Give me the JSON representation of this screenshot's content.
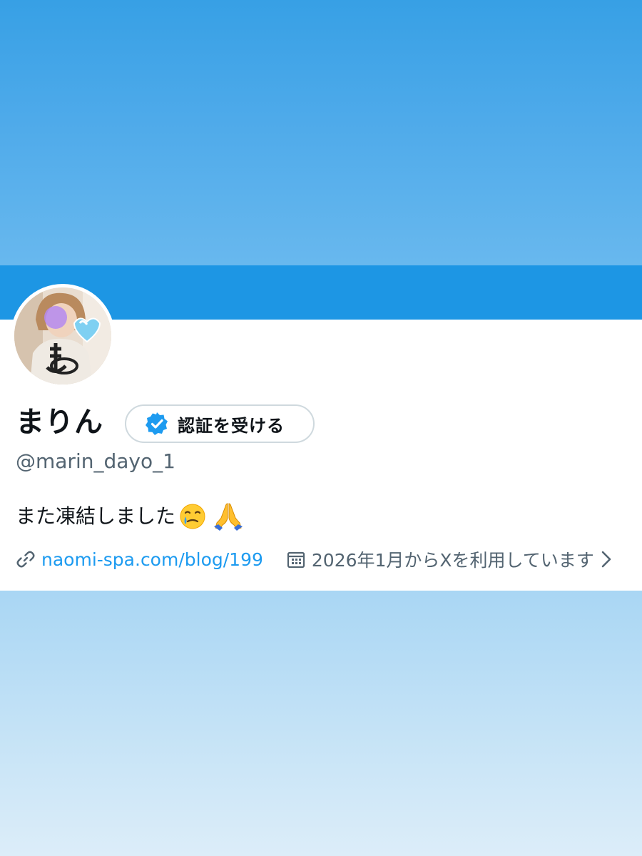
{
  "profile": {
    "display_name": "まりん",
    "handle": "@marin_dayo_1",
    "verify_button_label": "認証を受ける",
    "bio_text": "また凍結しました",
    "bio_emojis": [
      "smiling-face-with-tear",
      "folded-hands"
    ],
    "website": "naomi-spa.com/blog/199",
    "joined": "2026年1月からXを利用しています"
  },
  "icons": {
    "verify": "verified-badge-icon",
    "link": "link-icon",
    "calendar": "calendar-icon",
    "chevron": "chevron-right-icon"
  },
  "colors": {
    "banner": "#1d96e4",
    "top_background": "#37a0e5",
    "bottom_background": "#c3e2f6",
    "accent_link": "#1d9bf0",
    "verified_badge": "#1d9bf0",
    "secondary_text": "#536471",
    "primary_text": "#0f1419"
  }
}
